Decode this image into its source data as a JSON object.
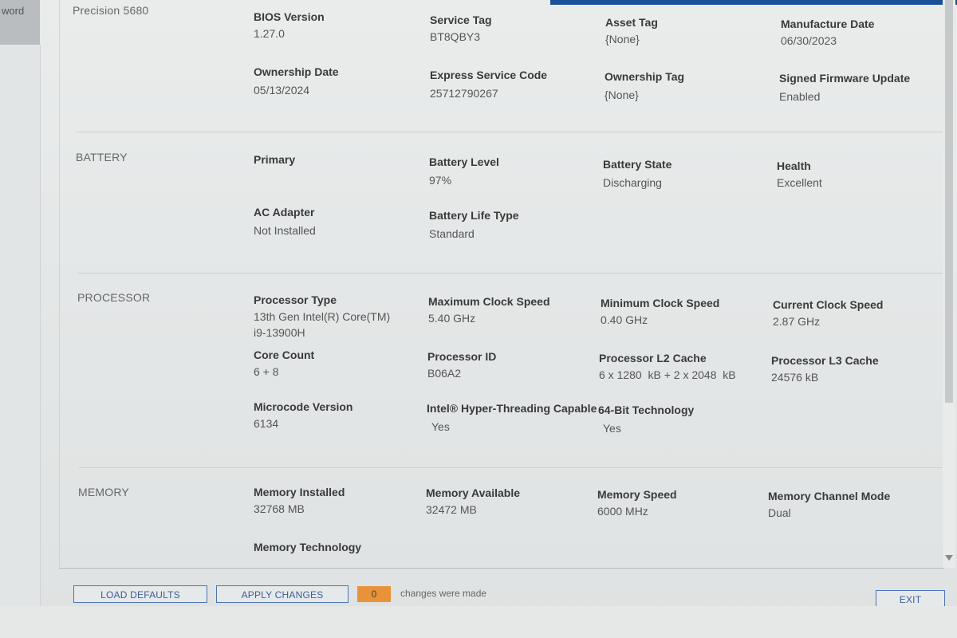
{
  "left_tab": {
    "label": "word"
  },
  "device": {
    "model": "Precision 5680"
  },
  "system": {
    "fields": [
      {
        "label": "BIOS Version",
        "value": "1.27.0"
      },
      {
        "label": "Service Tag",
        "value": "BT8QBY3"
      },
      {
        "label": "Asset Tag",
        "value": "{None}"
      },
      {
        "label": "Manufacture Date",
        "value": "06/30/2023"
      },
      {
        "label": "Ownership Date",
        "value": "05/13/2024"
      },
      {
        "label": "Express Service Code",
        "value": "25712790267"
      },
      {
        "label": "Ownership Tag",
        "value": "{None}"
      },
      {
        "label": "Signed Firmware Update",
        "value": "Enabled"
      }
    ]
  },
  "battery": {
    "title": "BATTERY",
    "fields": [
      {
        "label": "Primary",
        "value": ""
      },
      {
        "label": "Battery Level",
        "value": "97%"
      },
      {
        "label": "Battery State",
        "value": "Discharging"
      },
      {
        "label": "Health",
        "value": "Excellent"
      },
      {
        "label": "AC Adapter",
        "value": "Not Installed"
      },
      {
        "label": "Battery Life Type",
        "value": "Standard"
      }
    ]
  },
  "processor": {
    "title": "PROCESSOR",
    "fields": [
      {
        "label": "Processor Type",
        "value": "13th Gen Intel(R) Core(TM)",
        "value2": "i9-13900H"
      },
      {
        "label": "Maximum Clock Speed",
        "value": "5.40 GHz"
      },
      {
        "label": "Minimum Clock Speed",
        "value": "0.40 GHz"
      },
      {
        "label": "Current Clock Speed",
        "value": "2.87 GHz"
      },
      {
        "label": "Core Count",
        "value": "6 + 8"
      },
      {
        "label": "Processor ID",
        "value": "B06A2"
      },
      {
        "label": "Processor L2 Cache",
        "value": "6 x 1280  kB + 2 x 2048  kB"
      },
      {
        "label": "Processor L3 Cache",
        "value": "24576 kB"
      },
      {
        "label": "Microcode Version",
        "value": "6134"
      },
      {
        "label": "Intel® Hyper-Threading Capable",
        "value": "Yes"
      },
      {
        "label": "64-Bit Technology",
        "value": "Yes"
      }
    ]
  },
  "memory": {
    "title": "MEMORY",
    "fields": [
      {
        "label": "Memory Installed",
        "value": "32768 MB"
      },
      {
        "label": "Memory Available",
        "value": "32472 MB"
      },
      {
        "label": "Memory Speed",
        "value": "6000 MHz"
      },
      {
        "label": "Memory Channel Mode",
        "value": "Dual"
      },
      {
        "label": "Memory Technology",
        "value": ""
      }
    ]
  },
  "footer": {
    "load_defaults": "LOAD DEFAULTS",
    "apply_changes": "APPLY CHANGES",
    "changes_count": "0",
    "changes_text": "changes were made",
    "exit": "EXIT"
  }
}
